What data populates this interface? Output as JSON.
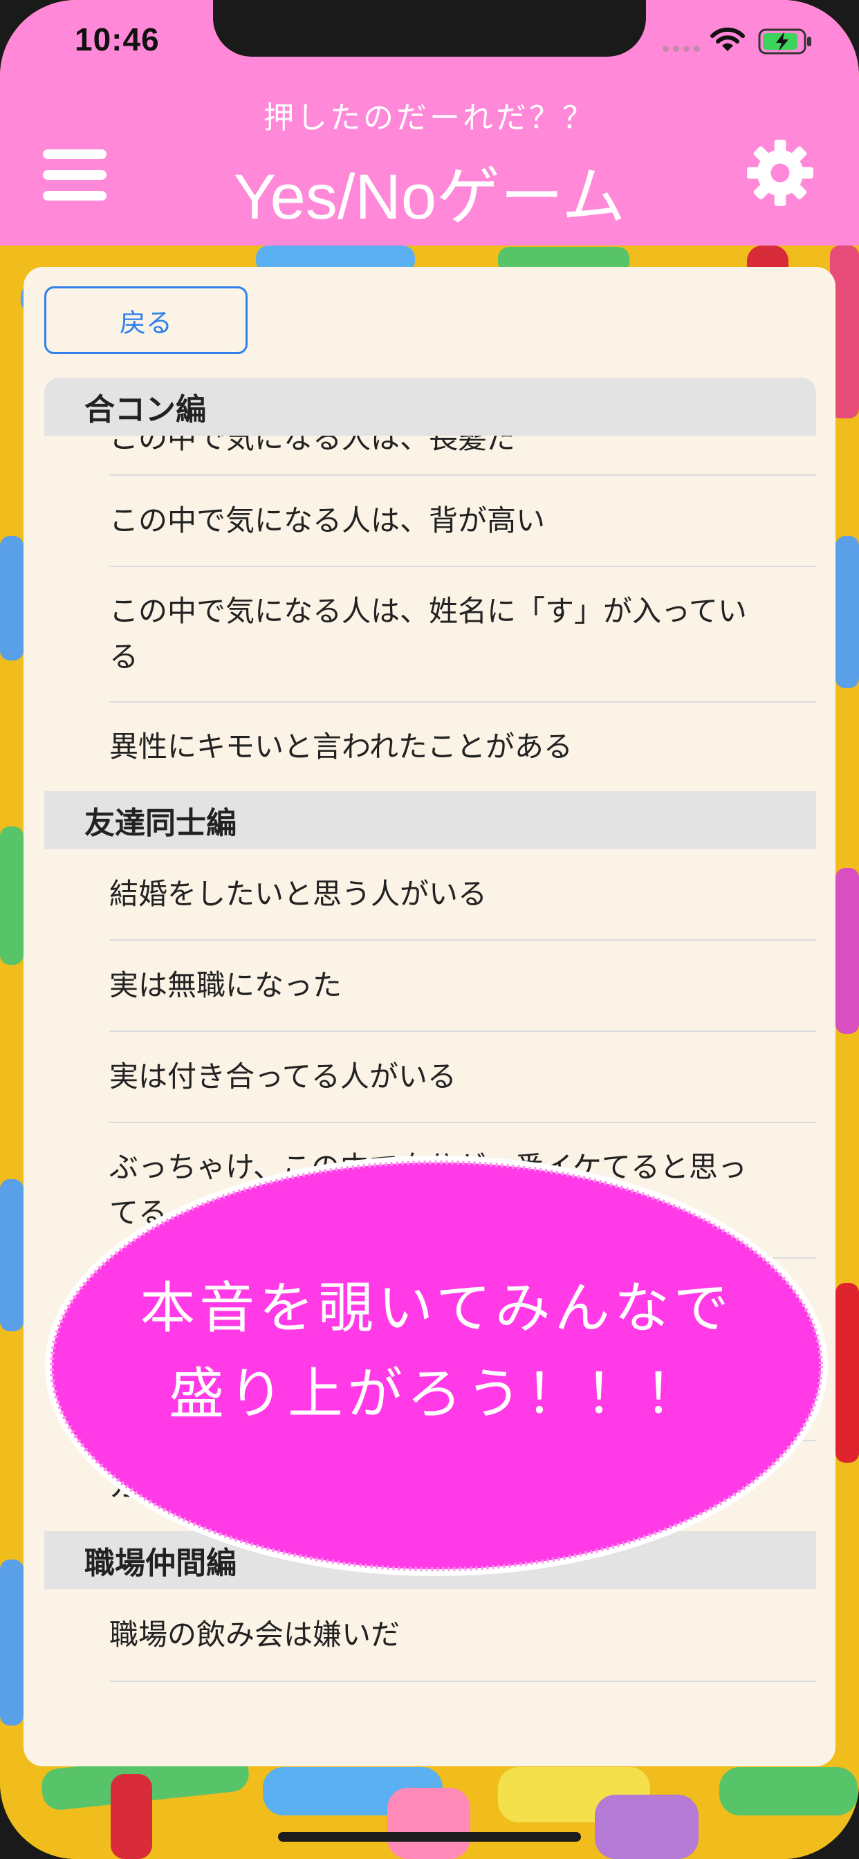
{
  "status_bar": {
    "time": "10:46"
  },
  "header": {
    "subtitle": "押したのだーれだ？？",
    "title": "Yes/Noゲーム",
    "menu_icon": "hamburger-menu-icon",
    "settings_icon": "gear-icon"
  },
  "card": {
    "back_label": "戻る",
    "sections": [
      {
        "title": "合コン編",
        "rows": [
          "この中で気になる人は、長髪だ",
          "この中で気になる人は、背が高い",
          "この中で気になる人は、姓名に「す」が入っている",
          "異性にキモいと言われたことがある"
        ]
      },
      {
        "title": "友達同士編",
        "rows": [
          "結婚をしたいと思う人がいる",
          "実は無職になった",
          "実は付き合ってる人がいる",
          "ぶっちゃけ、この中で自分が一番イケてると思ってる",
          "",
          "",
          "ガールズ"
        ]
      },
      {
        "title": "職場仲間編",
        "rows": [
          "職場の飲み会は嫌いだ"
        ]
      }
    ]
  },
  "overlay": {
    "line1": "本音を覗いてみんなで",
    "line2": "盛り上がろう！！！"
  },
  "colors": {
    "header_bg": "#ff88d8",
    "card_bg": "#faf3e6",
    "section_bg": "#e3e3e3",
    "accent_blue": "#2f80ed",
    "bubble": "#ff3ae6"
  }
}
